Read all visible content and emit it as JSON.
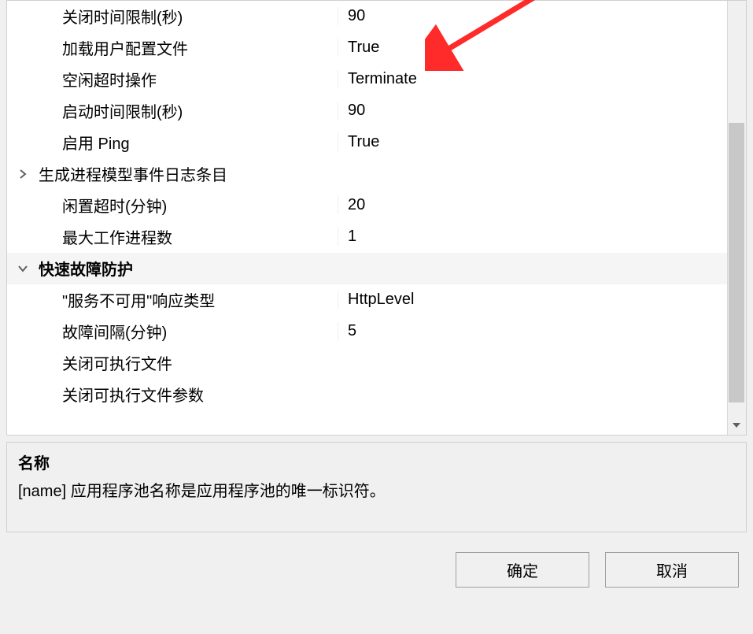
{
  "grid": {
    "rows": [
      {
        "type": "item",
        "label": "关闭时间限制(秒)",
        "value": "90"
      },
      {
        "type": "item",
        "label": "加载用户配置文件",
        "value": "True"
      },
      {
        "type": "item",
        "label": "空闲超时操作",
        "value": "Terminate"
      },
      {
        "type": "item",
        "label": "启动时间限制(秒)",
        "value": "90"
      },
      {
        "type": "item",
        "label": "启用 Ping",
        "value": "True"
      },
      {
        "type": "expandable",
        "label": "生成进程模型事件日志条目",
        "value": "",
        "expanded": false
      },
      {
        "type": "item",
        "label": "闲置超时(分钟)",
        "value": "20"
      },
      {
        "type": "item",
        "label": "最大工作进程数",
        "value": "1"
      },
      {
        "type": "category",
        "label": "快速故障防护",
        "value": "",
        "expanded": true
      },
      {
        "type": "item",
        "label": "\"服务不可用\"响应类型",
        "value": "HttpLevel"
      },
      {
        "type": "item",
        "label": "故障间隔(分钟)",
        "value": "5"
      },
      {
        "type": "item",
        "label": "关闭可执行文件",
        "value": ""
      },
      {
        "type": "item",
        "label": "关闭可执行文件参数",
        "value": ""
      }
    ]
  },
  "help": {
    "title": "名称",
    "description": "[name] 应用程序池名称是应用程序池的唯一标识符。"
  },
  "buttons": {
    "ok": "确定",
    "cancel": "取消"
  }
}
